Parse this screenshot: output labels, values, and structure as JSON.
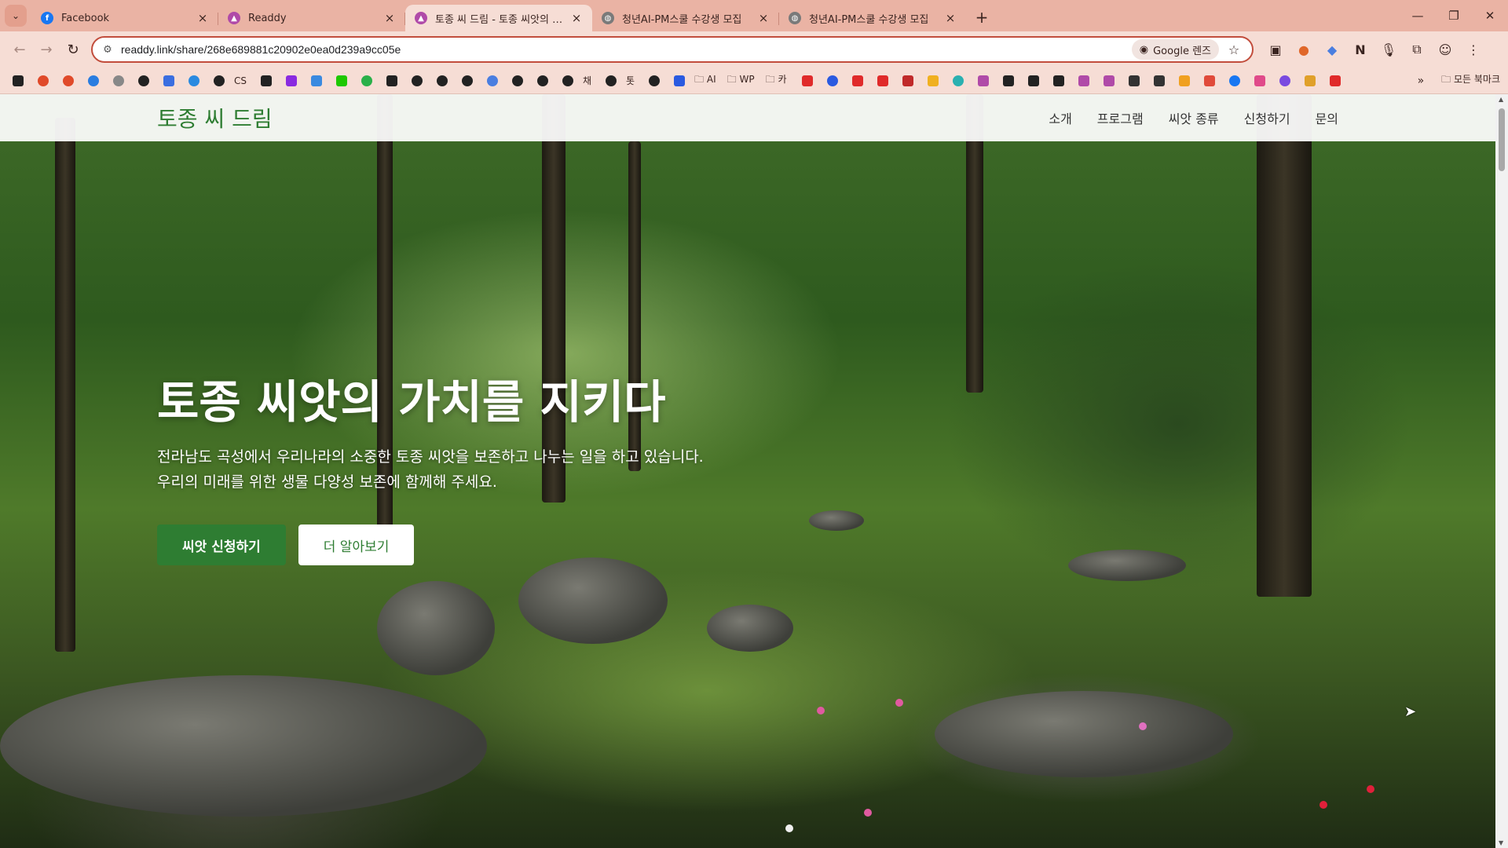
{
  "browser": {
    "tabs": [
      {
        "title": "Facebook",
        "favicon": "facebook-icon",
        "color": "#1877f2",
        "active": false
      },
      {
        "title": "Readdy",
        "favicon": "readdy-icon",
        "color": "#b04aa8",
        "active": false
      },
      {
        "title": "토종 씨 드림 - 토종 씨앗의 가치",
        "favicon": "readdy-icon",
        "color": "#b04aa8",
        "active": true
      },
      {
        "title": "청년AI-PM스쿨 수강생 모집",
        "favicon": "globe-icon",
        "color": "#7a7a7a",
        "active": false
      },
      {
        "title": "청년AI-PM스쿨 수강생 모집",
        "favicon": "globe-icon",
        "color": "#7a7a7a",
        "active": false
      }
    ],
    "new_tab_label": "+",
    "url": "readdy.link/share/268e689881c20902e0ea0d239a9cc05e",
    "lens_label": "Google 렌즈",
    "bookmarks": {
      "text_items": [
        "CS",
        "채",
        "톳",
        "AI",
        "WP",
        "카"
      ],
      "all_bookmarks_label": "모든 북마크"
    },
    "accent_color": "#c24d3c",
    "chrome_color": "#f6ddd5"
  },
  "site": {
    "logo": "토종 씨 드림",
    "nav": [
      "소개",
      "프로그램",
      "씨앗 종류",
      "신청하기",
      "문의"
    ],
    "brand_color": "#2e7d32"
  },
  "hero": {
    "title": "토종 씨앗의 가치를 지키다",
    "description": "전라남도 곡성에서 우리나라의 소중한 토종 씨앗을 보존하고 나누는 일을 하고 있습니다. 우리의 미래를 위한 생물 다양성 보존에 함께해 주세요.",
    "primary_button": "씨앗 신청하기",
    "secondary_button": "더 알아보기"
  }
}
